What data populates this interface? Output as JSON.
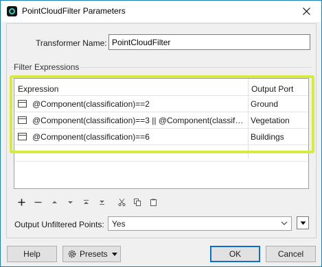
{
  "window": {
    "title": "PointCloudFilter Parameters"
  },
  "transformer": {
    "label": "Transformer Name:",
    "value": "PointCloudFilter"
  },
  "filter_expressions": {
    "group_label": "Filter Expressions",
    "columns": [
      "Expression",
      "Output Port"
    ],
    "rows": [
      {
        "expression": "@Component(classification)==2",
        "port": "Ground"
      },
      {
        "expression": "@Component(classification)==3 || @Component(classific...",
        "port": "Vegetation"
      },
      {
        "expression": "@Component(classification)==6",
        "port": "Buildings"
      }
    ]
  },
  "toolbar": {
    "icons": [
      "add-icon",
      "remove-icon",
      "move-up-icon",
      "move-down-icon",
      "move-top-icon",
      "move-bottom-icon",
      "cut-icon",
      "copy-icon",
      "paste-icon"
    ]
  },
  "output_unfiltered": {
    "label": "Output Unfiltered Points:",
    "value": "Yes"
  },
  "buttons": {
    "help": "Help",
    "presets": "Presets",
    "ok": "OK",
    "cancel": "Cancel"
  },
  "colors": {
    "highlight": "#d7ec3a",
    "accent": "#0a6dd1",
    "app_icon_ring": "#2fd0c8"
  }
}
